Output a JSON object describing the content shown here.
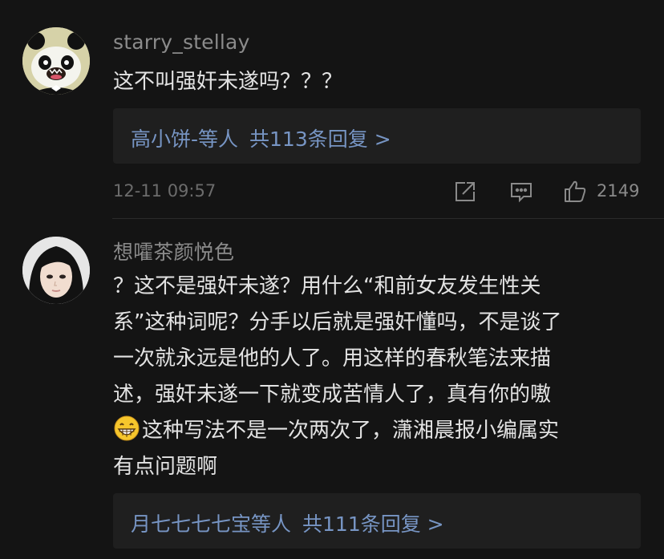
{
  "comments": [
    {
      "username": "starry_stellay",
      "text": "这不叫强奸未遂吗？？？",
      "replies": {
        "names": "高小饼-等人",
        "count_text": "共113条回复 >"
      },
      "timestamp": "12-11 09:57",
      "likes": "2149",
      "avatar_icon": "panda-avatar",
      "icons": [
        "share-icon",
        "comment-icon",
        "thumbs-up-icon"
      ]
    },
    {
      "username": "想嚯茶颜悦色",
      "lines": [
        "？这不是强奸未遂？用什么“和前女友发生性关",
        "系”这种词呢？分手以后就是强奸懂吗，不是谈了",
        "一次就永远是他的人了。用这样的春秋笔法来描",
        "述，强奸未遂一下就变成苦情人了，真有你的嗷"
      ],
      "line5_after_emoji": "这种写法不是一次两次了，潇湘晨报小编属实",
      "line6": "有点问题啊",
      "emoji_icon": "grinning-emoji",
      "replies": {
        "names": "月七七七七宝等人",
        "count_text": "共111条回复 >"
      },
      "avatar_icon": "person-avatar"
    }
  ],
  "colors": {
    "background": "#141414",
    "username": "#8b8b8b",
    "body": "#e3e3e3",
    "link": "#7795c4",
    "reply_box": "#1f1f1f"
  }
}
